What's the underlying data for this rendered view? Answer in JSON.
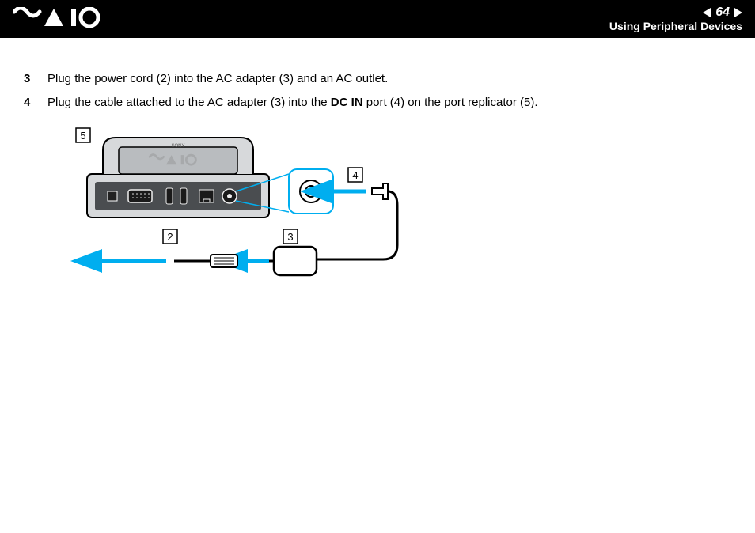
{
  "header": {
    "logo_alt": "VAIO",
    "page_number": "64",
    "section": "Using Peripheral Devices"
  },
  "steps": [
    {
      "num": "3",
      "text_before": "Plug the power cord (2) into the AC adapter (3) and an AC outlet.",
      "bold": "",
      "text_after": ""
    },
    {
      "num": "4",
      "text_before": "Plug the cable attached to the AC adapter (3) into the ",
      "bold": "DC IN",
      "text_after": " port (4) on the port replicator (5)."
    }
  ],
  "figure": {
    "callouts": {
      "c2": "2",
      "c3": "3",
      "c4": "4",
      "c5": "5"
    },
    "device_label": "SONY",
    "device_logo": "VAIO"
  },
  "colors": {
    "accent": "#00AEEF",
    "black": "#000000",
    "white": "#FFFFFF"
  }
}
